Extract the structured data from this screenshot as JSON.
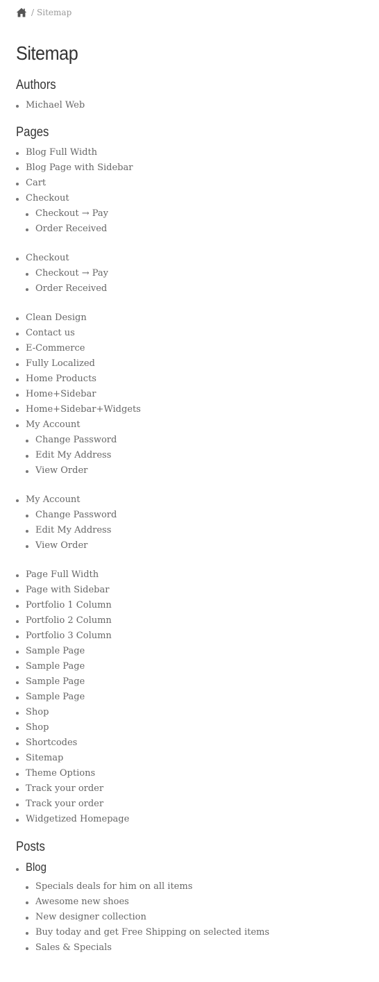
{
  "breadcrumb": {
    "separator": "/",
    "current": "Sitemap"
  },
  "page_title": "Sitemap",
  "authors": {
    "heading": "Authors",
    "items": [
      "Michael Web"
    ]
  },
  "pages": {
    "heading": "Pages",
    "items": [
      {
        "label": "Blog Full Width"
      },
      {
        "label": "Blog Page with Sidebar"
      },
      {
        "label": "Cart"
      },
      {
        "label": "Checkout",
        "children": [
          "Checkout → Pay",
          "Order Received"
        ]
      },
      {
        "label": "Checkout",
        "children": [
          "Checkout → Pay",
          "Order Received"
        ]
      },
      {
        "label": "Clean Design"
      },
      {
        "label": "Contact us"
      },
      {
        "label": "E-Commerce"
      },
      {
        "label": "Fully Localized"
      },
      {
        "label": "Home Products"
      },
      {
        "label": "Home+Sidebar"
      },
      {
        "label": "Home+Sidebar+Widgets"
      },
      {
        "label": "My Account",
        "children": [
          "Change Password",
          "Edit My Address",
          "View Order"
        ]
      },
      {
        "label": "My Account",
        "children": [
          "Change Password",
          "Edit My Address",
          "View Order"
        ]
      },
      {
        "label": "Page Full Width"
      },
      {
        "label": "Page with Sidebar"
      },
      {
        "label": "Portfolio 1 Column"
      },
      {
        "label": "Portfolio 2 Column"
      },
      {
        "label": "Portfolio 3 Column"
      },
      {
        "label": "Sample Page"
      },
      {
        "label": "Sample Page"
      },
      {
        "label": "Sample Page"
      },
      {
        "label": "Sample Page"
      },
      {
        "label": "Shop"
      },
      {
        "label": "Shop"
      },
      {
        "label": "Shortcodes"
      },
      {
        "label": "Sitemap"
      },
      {
        "label": "Theme Options"
      },
      {
        "label": "Track your order"
      },
      {
        "label": "Track your order"
      },
      {
        "label": "Widgetized Homepage"
      }
    ]
  },
  "posts": {
    "heading": "Posts",
    "categories": [
      {
        "label": "Blog",
        "items": [
          "Specials deals for him on all items",
          "Awesome new shoes",
          "New designer collection",
          "Buy today and get Free Shipping on selected items",
          "Sales & Specials"
        ]
      }
    ]
  },
  "icons": {
    "home": "home-icon"
  },
  "colors": {
    "text": "#666666",
    "heading": "#333333",
    "muted": "#999999"
  }
}
